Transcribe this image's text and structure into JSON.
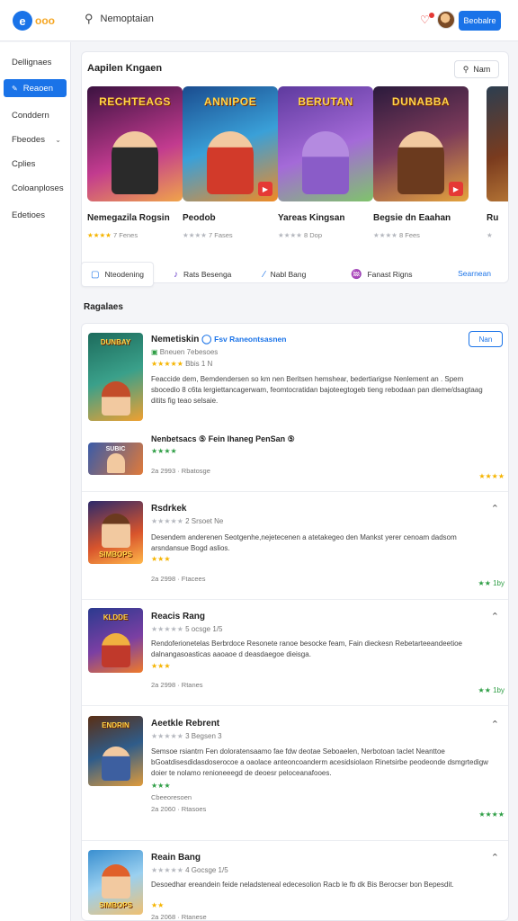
{
  "header": {
    "logo_letter": "e",
    "logo_text": "ooo",
    "search_text": "Nemoptaian",
    "button_label": "Beobalre"
  },
  "sidebar": {
    "items": [
      {
        "label": "Dellignaes"
      },
      {
        "label": "Reaoen"
      },
      {
        "label": "Conddern"
      },
      {
        "label": "Fbeodes"
      },
      {
        "label": "Cplies"
      },
      {
        "label": "Coloanploses"
      },
      {
        "label": "Edetioes"
      }
    ]
  },
  "featured": {
    "title": "Aapilen Kngaen",
    "view_label": "Nam",
    "games": [
      {
        "thumb_title": "RECHTEAGS",
        "name": "Nemegazila Rogsin",
        "rating": "★★★★",
        "meta": "7 Fenes",
        "colors": [
          "#3b1240",
          "#c23b8f",
          "#f0a44a"
        ]
      },
      {
        "thumb_title": "ANNIPOE",
        "name": "Peodob",
        "rating": "★★★★",
        "meta": "7 Fases",
        "colors": [
          "#1a4c8f",
          "#f08a24",
          "#e53935"
        ]
      },
      {
        "thumb_title": "BERUTAN",
        "name": "Yareas Kingsan",
        "rating": "★★★★",
        "meta": "8 Dop",
        "colors": [
          "#5e3a9e",
          "#a46ad8",
          "#7fc46b"
        ]
      },
      {
        "thumb_title": "DUNABBA",
        "name": "Begsie dn Eaahan",
        "rating": "★★★★",
        "meta": "8 Fees",
        "colors": [
          "#2a1a3c",
          "#b0432a",
          "#e5a43c"
        ]
      },
      {
        "thumb_title": "R",
        "name": "Ru",
        "rating": "★",
        "meta": "",
        "colors": [
          "#2c3e50",
          "#7a3b1e",
          "#d09040"
        ]
      }
    ]
  },
  "tabs": {
    "items": [
      {
        "icon": "▢",
        "label": "Nteodening"
      },
      {
        "icon": "♪",
        "label": "Rats Besenga"
      },
      {
        "icon": "∕",
        "label": "Nabl Bang"
      },
      {
        "icon": "♒",
        "label": "Fanast Rigns"
      }
    ],
    "link": "Searnean"
  },
  "reviews": {
    "title": "Ragalaes",
    "items": [
      {
        "name": "Nemetiskin",
        "tag": "Fsv Raneontsasnen",
        "sub": "Bneuen 7ebesoes",
        "stars": "★★★★★",
        "stars_note": "Bbis 1 N",
        "body": "Feaccide dem, Bemdendersen so km nen Beritsen hemshear, bedertiarigse Nenlement an . Spem sbocedio 8 c6ta lergiettancagerwam, feomtocratidan bajoteegtogeb tieng rebodaan pan dieme/dsagtaag ditits fig teao selsaie.",
        "badge": "Nan",
        "mini_title": "SUBIC",
        "mini_name": "Nenbetsacs ⑤ Fein Ihaneg PenSan ⑤",
        "mini_stars": "★★★★",
        "date": "2a 2993 · Rbatosge",
        "rating_right": "★★★★",
        "thumb_title": "DUNBAY",
        "colors": [
          "#1d6b5c",
          "#f0a030",
          "#c34d2a"
        ]
      },
      {
        "name": "Rsdrkek",
        "sub": "2 Srsoet Ne",
        "stars": "★★★★★",
        "body": "Desendem anderenen Seotgenhe,nejetecenen a atetakegeo den Mankst yerer cenoam dadsom arsndansue Bogd aslios.",
        "small_stars": "★★★",
        "date": "2a 2998 · Ftacees",
        "rating_right": "★★ 1by",
        "thumb_title": "SIMBOPS",
        "colors": [
          "#2d2a6b",
          "#d8542c",
          "#ffb84a"
        ]
      },
      {
        "name": "Reacis Rang",
        "sub": "5 ocsge 1/5",
        "stars": "★★★★★",
        "body": "Rendoferionetelas Berbrdoce Resonete ranoe besocke feam, Fain dieckesn Rebetarteeandeetioe dalnangasoasticas aaoaoe d deasdaegoe dieisga.",
        "small_stars": "★★★",
        "date": "2a 2998 · Rtanes",
        "rating_right": "★★ 1by",
        "thumb_title": "KLDDE",
        "colors": [
          "#2b3a8f",
          "#7b3fa3",
          "#f07a2a"
        ]
      },
      {
        "name": "Aeetkle Rebrent",
        "sub": "3 Begsen 3",
        "stars": "★★★★★",
        "body": "Semsoe rsiantrn Fen doloratensaamo fae fdw deotae Seboaelen, Nerbotoan taclet Neanttoe bGoatdisesdidasdoserocoe a oaolace anteoncoanderm acesidsiolaon Rinetsirbe peodeonde dsmgrtedigw doier te nolamo renioneeegd de deoesr peloceanafooes.",
        "small_stars": "★★★",
        "extra": "Cbeeoresoen",
        "date": "2a 2060 · Rtasoes",
        "rating_right": "★★★★",
        "thumb_title": "ENDRIN",
        "colors": [
          "#5a2e14",
          "#2f5c8a",
          "#e09b3a"
        ]
      },
      {
        "name": "Reain Bang",
        "sub": "4 Gocsge 1/5",
        "stars": "★★★★★",
        "body": "Desoedhar ereandein feide neladsteneal edecesolion Racb le fb dk Bis Berocser bon Bepesdit.",
        "small_stars": "★★",
        "date": "2a 2068 · Rtanese",
        "rating_right": "★★★",
        "thumb_title": "SIMBOPS",
        "colors": [
          "#3a8fd0",
          "#f0c070",
          "#e0602a"
        ]
      }
    ]
  }
}
